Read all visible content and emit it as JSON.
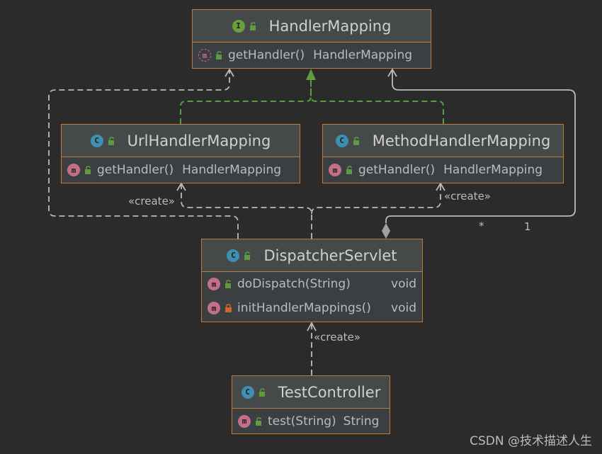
{
  "classes": [
    {
      "id": "handler-mapping",
      "kind": "I",
      "name": "HandlerMapping",
      "methods": [
        {
          "kind": "m-abstract",
          "visibility": "public",
          "name": "getHandler()",
          "ret": "HandlerMapping"
        }
      ]
    },
    {
      "id": "url-handler-mapping",
      "kind": "C",
      "name": "UrlHandlerMapping",
      "methods": [
        {
          "kind": "m",
          "visibility": "public",
          "name": "getHandler()",
          "ret": "HandlerMapping"
        }
      ]
    },
    {
      "id": "method-handler-mapping",
      "kind": "C",
      "name": "MethodHandlerMapping",
      "methods": [
        {
          "kind": "m",
          "visibility": "public",
          "name": "getHandler()",
          "ret": "HandlerMapping"
        }
      ]
    },
    {
      "id": "dispatcher-servlet",
      "kind": "C",
      "name": "DispatcherServlet",
      "methods": [
        {
          "kind": "m",
          "visibility": "public",
          "name": "doDispatch(String)",
          "ret": "void"
        },
        {
          "kind": "m",
          "visibility": "private",
          "name": "initHandlerMappings()",
          "ret": "void"
        }
      ]
    },
    {
      "id": "test-controller",
      "kind": "C",
      "name": "TestController",
      "methods": [
        {
          "kind": "m",
          "visibility": "public",
          "name": "test(String)",
          "ret": "String"
        }
      ]
    }
  ],
  "relations": {
    "create_label": "«create»",
    "multiplicity_many": "*",
    "multiplicity_one": "1"
  },
  "watermark": "CSDN @技术描述人生",
  "colors": {
    "background": "#2b2b2b",
    "box_border": "#c27a38",
    "box_fill": "#3c3f41",
    "dependency_line": "#bbbbbb",
    "realization_line": "#5f9a3f",
    "association_line": "#bbbbbb",
    "public_lock": "#5f9a3f",
    "private_lock": "#d0642a"
  }
}
